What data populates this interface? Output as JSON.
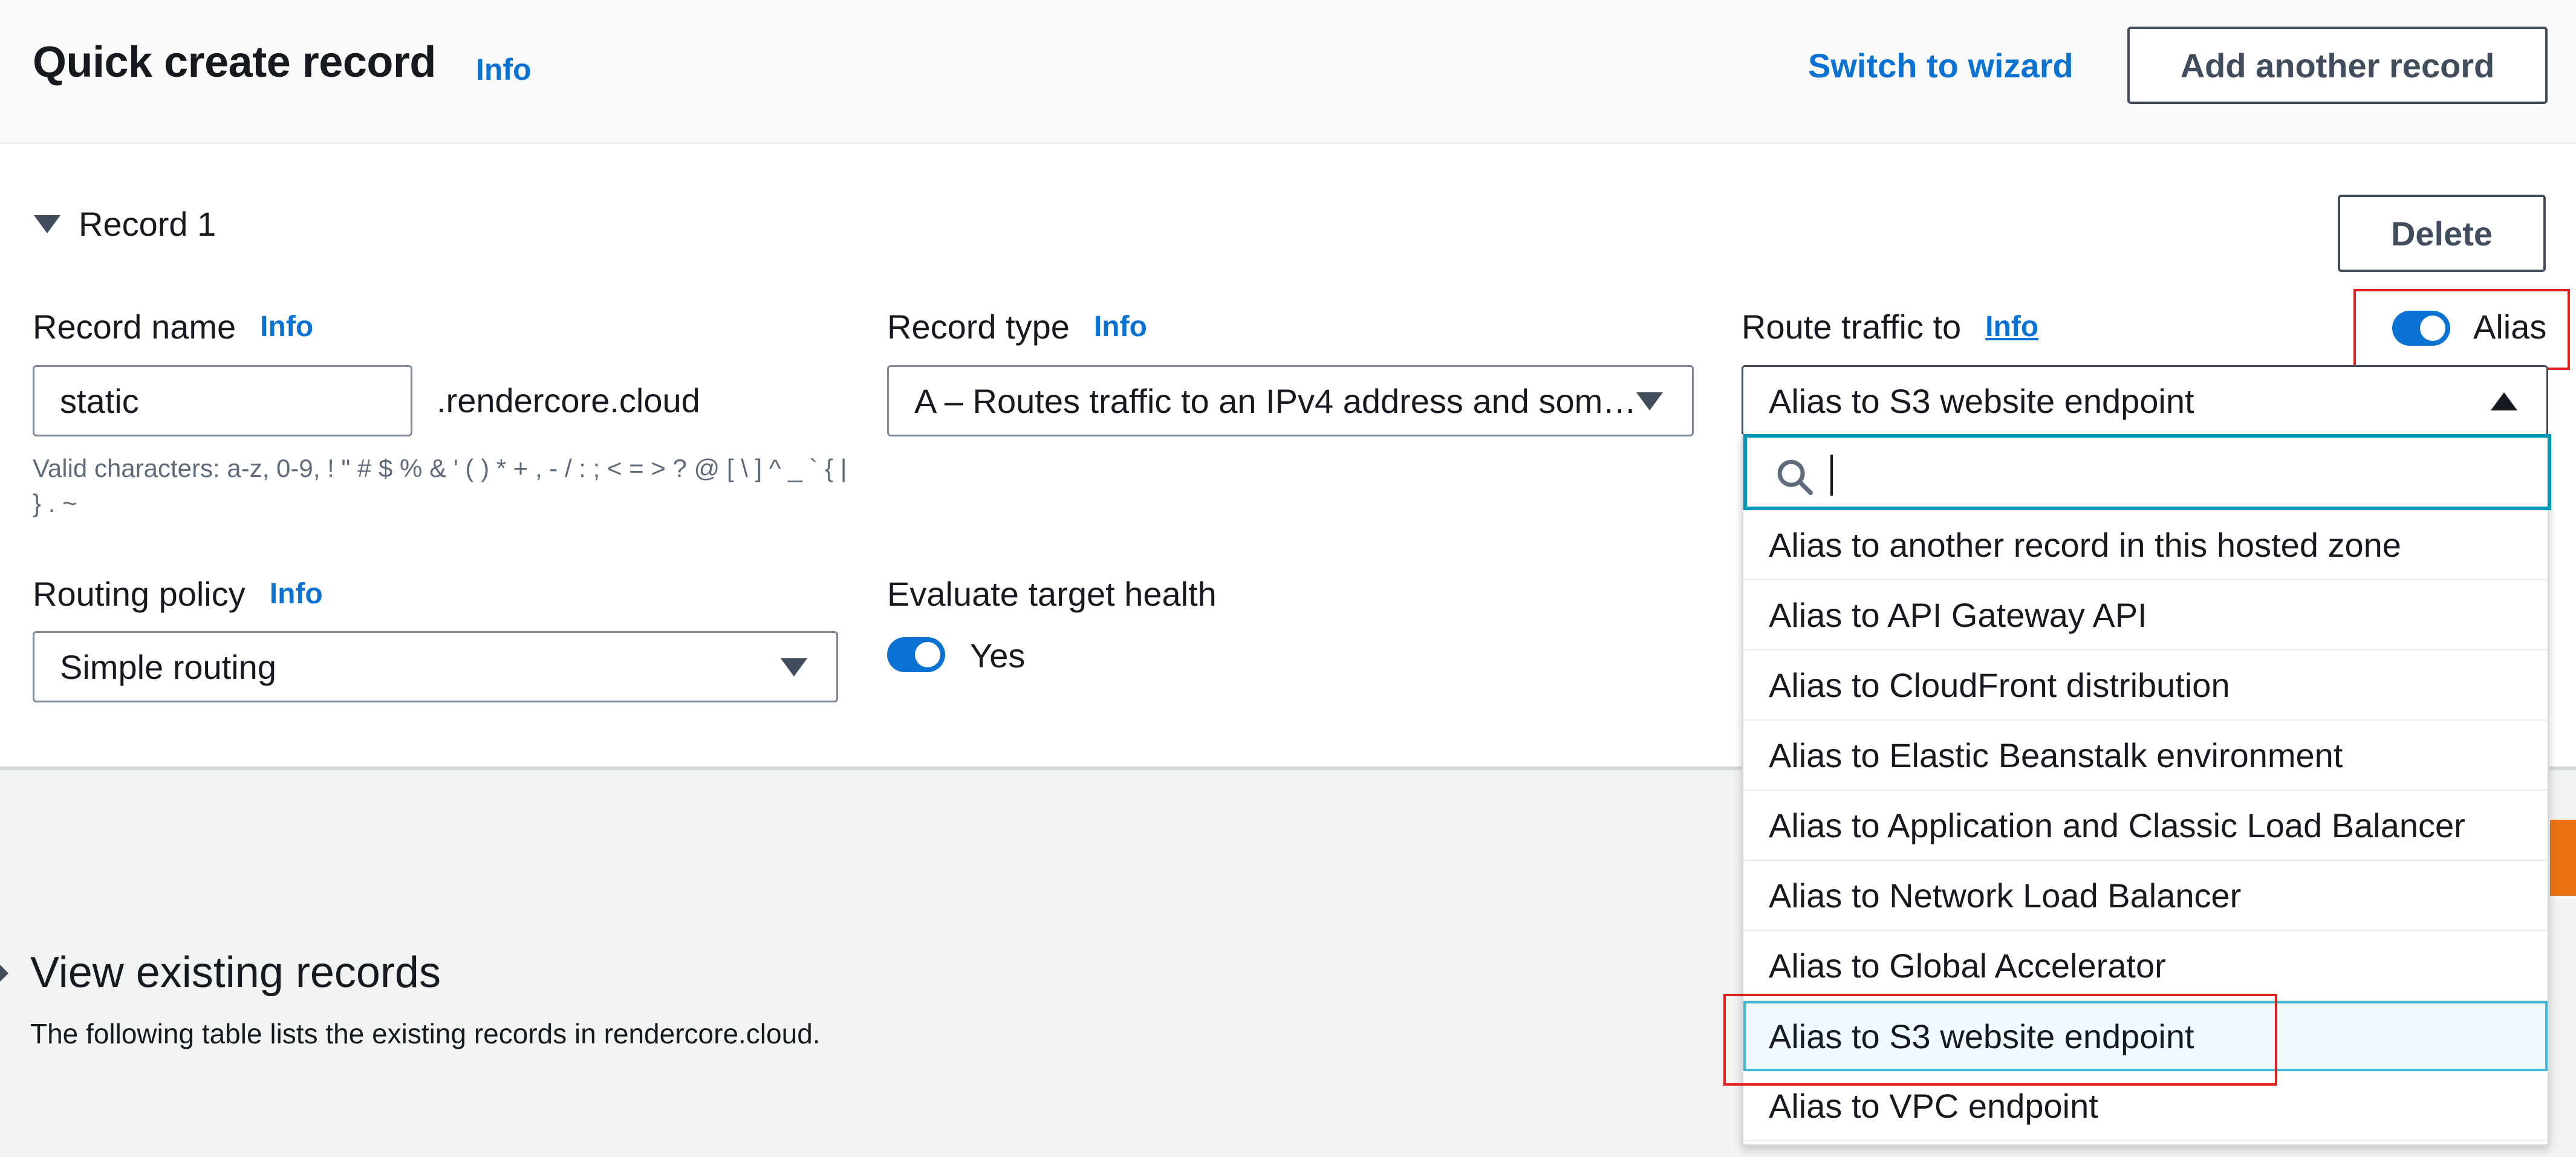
{
  "header": {
    "title": "Quick create record",
    "info": "Info",
    "switch_wizard": "Switch to wizard",
    "add_record": "Add another record"
  },
  "record": {
    "title": "Record 1",
    "delete": "Delete",
    "record_name": {
      "label": "Record name",
      "info": "Info",
      "value": "static",
      "suffix": ".rendercore.cloud",
      "hint": "Valid characters: a-z, 0-9, ! \" # $ % & ' ( ) * + , - / : ; < = > ? @ [ \\ ] ^ _ ` { | } . ~"
    },
    "record_type": {
      "label": "Record type",
      "info": "Info",
      "value": "A – Routes traffic to an IPv4 address and some AWS resources"
    },
    "route_traffic": {
      "label": "Route traffic to",
      "info": "Info",
      "alias_label": "Alias",
      "alias_enabled": true,
      "value": "Alias to S3 website endpoint",
      "search_value": "",
      "options": [
        "Alias to another record in this hosted zone",
        "Alias to API Gateway API",
        "Alias to CloudFront distribution",
        "Alias to Elastic Beanstalk environment",
        "Alias to Application and Classic Load Balancer",
        "Alias to Network Load Balancer",
        "Alias to Global Accelerator",
        "Alias to S3 website endpoint",
        "Alias to VPC endpoint"
      ],
      "selected_option": "Alias to S3 website endpoint"
    },
    "routing_policy": {
      "label": "Routing policy",
      "info": "Info",
      "value": "Simple routing"
    },
    "evaluate_health": {
      "label": "Evaluate target health",
      "toggle_label": "Yes",
      "enabled": true
    }
  },
  "existing_records": {
    "title": "View existing records",
    "description": "The following table lists the existing records in rendercore.cloud."
  },
  "icons": {
    "search": "search-icon",
    "caret": "caret-down-icon"
  },
  "colors": {
    "link": "#0972d3",
    "toggle_on": "#0972d3",
    "focus": "#0099ba",
    "annotation": "#e0201d",
    "accent_orange": "#ec7211"
  }
}
